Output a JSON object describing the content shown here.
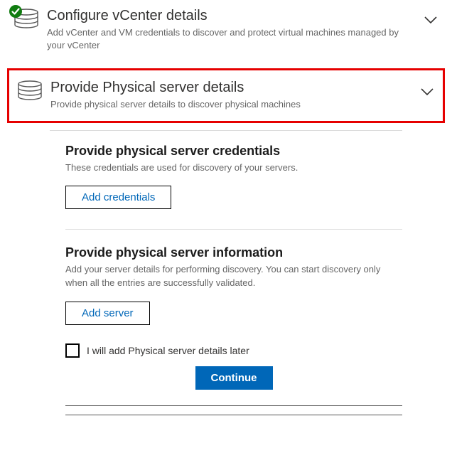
{
  "step_vcenter": {
    "title": "Configure vCenter details",
    "subtitle": "Add vCenter and VM credentials to discover and protect virtual machines managed by your vCenter"
  },
  "step_physical": {
    "title": "Provide Physical server details",
    "subtitle": "Provide physical server details to discover physical machines"
  },
  "credentials_section": {
    "title": "Provide physical server credentials",
    "subtitle": "These credentials are used for discovery of your servers.",
    "button_label": "Add credentials"
  },
  "info_section": {
    "title": "Provide physical server information",
    "subtitle": "Add your server details for performing discovery. You can start discovery only when all the entries are successfully validated.",
    "button_label": "Add server"
  },
  "later_checkbox_label": "I will add Physical server details later",
  "continue_label": "Continue"
}
